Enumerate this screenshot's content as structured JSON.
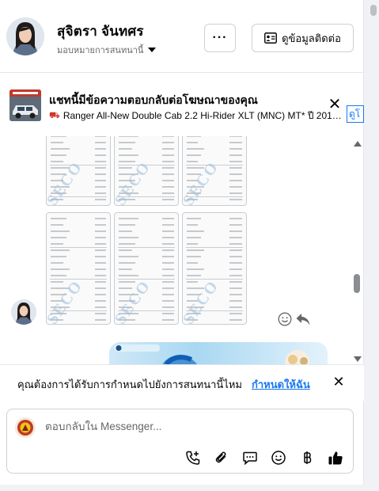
{
  "header": {
    "name": "สุจิตรา จันทศร",
    "assign_label": "มอบหมายการสนทนานี้",
    "more_label": "···",
    "contact_label": "ดูข้อมูลติดต่อ"
  },
  "ad": {
    "title": "แชทนี้มีข้อความตอบกลับต่อโฆษณาของคุณ",
    "subtitle": "Ranger All-New Double Cab 2.2 Hi-Rider XLT (MNC) MT* ปี 201…",
    "close_label": "ดูโ"
  },
  "notice": {
    "text": "คุณต้องการได้รับการกำหนดไปยังการสนทนานี้ไหม",
    "link": "กำหนดให้ฉัน"
  },
  "composer": {
    "placeholder": "ตอบกลับใน Messenger..."
  },
  "colors": {
    "accent": "#1877f2",
    "secondary_text": "#65676b",
    "border": "#ced0d4"
  },
  "icons": [
    "more-icon",
    "contact-card-icon",
    "close-icon",
    "smiley-icon",
    "reply-icon",
    "call-add-icon",
    "attach-icon",
    "chat-bubble-icon",
    "emoji-icon",
    "baht-icon",
    "like-icon",
    "scroll-up-icon",
    "scroll-down-icon"
  ]
}
